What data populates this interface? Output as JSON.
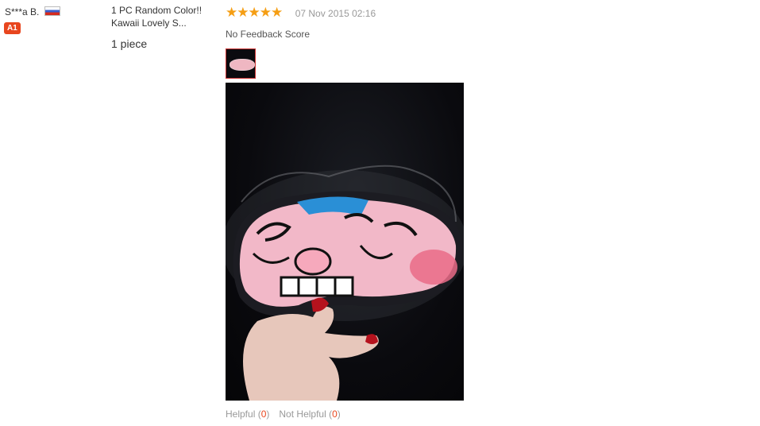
{
  "buyer": {
    "name": "S***a B.",
    "level": "A1",
    "country_flag_icon": "flag-icon-russia"
  },
  "product": {
    "title_line1": "1 PC Random Color!!",
    "title_line2": "Kawaii Lovely S...",
    "quantity": "1 piece"
  },
  "review": {
    "rating": 5,
    "rating_max": 5,
    "date": "07 Nov 2015 02:16",
    "feedback_score": "No Feedback Score",
    "photo_icon": "review-photo-thumbnail"
  },
  "votes": {
    "helpful_label": "Helpful",
    "helpful_count": "0",
    "not_helpful_label": "Not Helpful",
    "not_helpful_count": "0"
  },
  "colors": {
    "star": "#f59e14",
    "badge": "#e8461e",
    "count": "#e8461e"
  }
}
